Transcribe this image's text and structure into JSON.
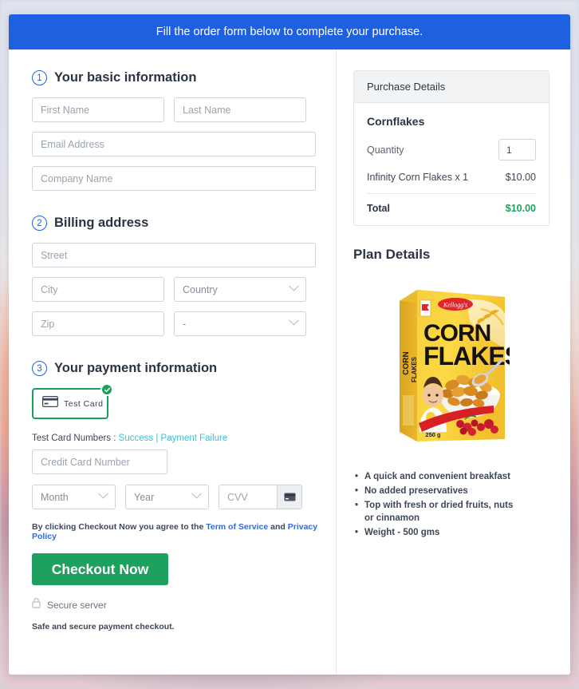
{
  "banner": {
    "text": "Fill the order form below to complete your purchase."
  },
  "sections": {
    "basic": {
      "number": "1",
      "title": "Your basic information",
      "fields": {
        "first_name": "First Name",
        "last_name": "Last Name",
        "email": "Email Address",
        "company": "Company Name"
      }
    },
    "billing": {
      "number": "2",
      "title": "Billing address",
      "fields": {
        "street": "Street",
        "city": "City",
        "country": "Country",
        "zip": "Zip",
        "state": "-"
      }
    },
    "payment": {
      "number": "3",
      "title": "Your payment information",
      "method_tile": {
        "label": "Test  Card",
        "icon": "credit-card-icon",
        "selected_badge": "check-circle-icon"
      },
      "test_cards": {
        "prefix": "Test Card Numbers :",
        "success": "Success",
        "separator": "|",
        "failure": "Payment Failure"
      },
      "fields": {
        "card_number": "Credit Card Number",
        "month": "Month",
        "year": "Year",
        "cvv": "CVV"
      },
      "cvv_icon": "credit-card-icon",
      "terms": {
        "before": "By clicking Checkout Now you agree to the ",
        "tos": "Term of Service",
        "and": " and ",
        "privacy": "Privacy Policy"
      },
      "checkout_button": "Checkout Now",
      "secure_server": "Secure server",
      "secure_note": "Safe and secure payment checkout."
    }
  },
  "purchase": {
    "panel_title": "Purchase Details",
    "product": "Cornflakes",
    "quantity_label": "Quantity",
    "quantity_value": "1",
    "line_item": "Infinity Corn Flakes x 1",
    "line_price": "$10.00",
    "total_label": "Total",
    "total_value": "$10.00"
  },
  "plan": {
    "title": "Plan Details",
    "product_image_alt": "corn-flakes-box",
    "box_text": {
      "brand": "Kellogg's",
      "line1": "CORN",
      "line2": "FLAKES",
      "weight": "250 g"
    },
    "features": [
      "A quick and convenient breakfast",
      "No added preservatives",
      "Top with fresh or dried fruits, nuts or cinnamon",
      "Weight - 500 gms"
    ]
  },
  "colors": {
    "banner_blue": "#1f60e0",
    "accent_green": "#1ea05e",
    "link_teal": "#39c2d3",
    "link_blue": "#2f6ae0"
  }
}
